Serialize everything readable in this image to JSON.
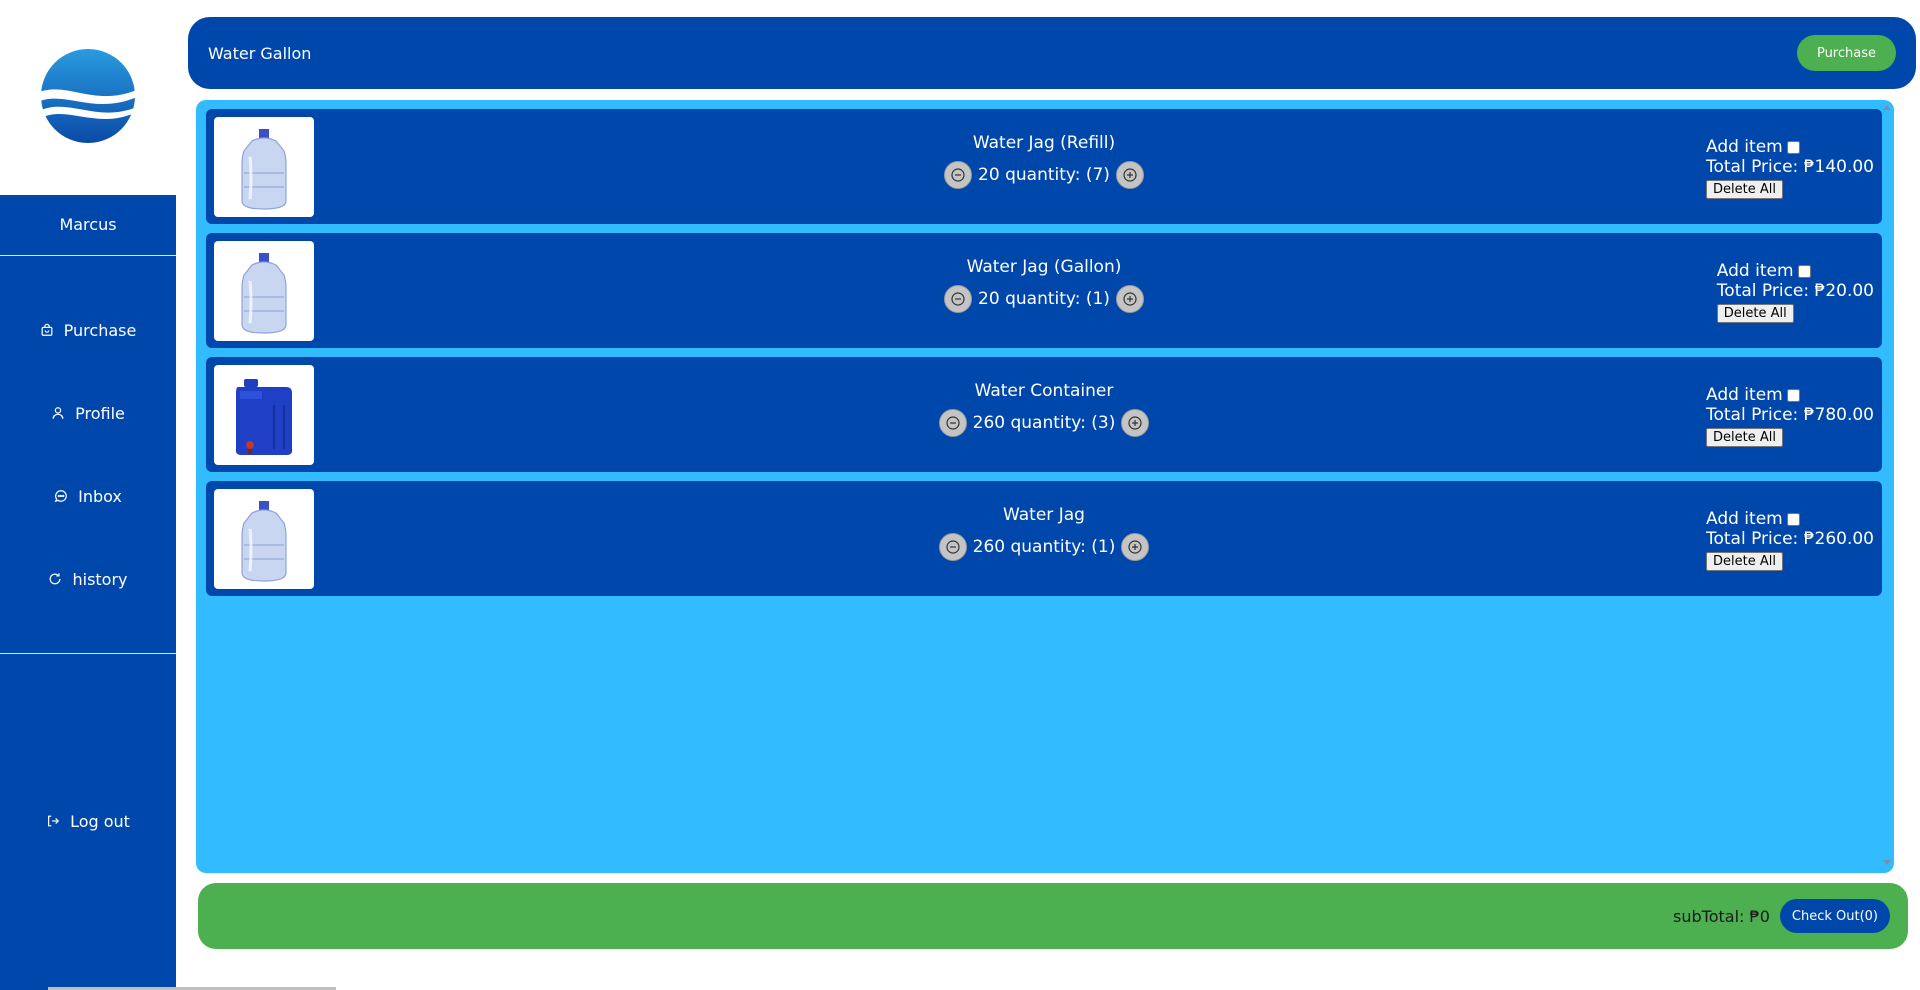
{
  "sidebar": {
    "user_name": "Marcus",
    "nav": [
      {
        "label": "Purchase",
        "icon": "bag-icon"
      },
      {
        "label": "Profile",
        "icon": "user-icon"
      },
      {
        "label": "Inbox",
        "icon": "chat-icon"
      },
      {
        "label": "history",
        "icon": "refresh-icon"
      }
    ],
    "logout": {
      "label": "Log out",
      "icon": "logout-icon"
    }
  },
  "header": {
    "title": "Water Gallon",
    "purchase_label": "Purchase"
  },
  "cart": {
    "add_label": "Add item",
    "delete_label": "Delete All",
    "items": [
      {
        "name": "Water Jag (Refill)",
        "qty_text": "20 quantity: (7)",
        "total": "Total Price: ₱140.00",
        "image": "water-jug"
      },
      {
        "name": "Water Jag (Gallon)",
        "qty_text": "20 quantity: (1)",
        "total": "Total Price: ₱20.00",
        "image": "water-jug"
      },
      {
        "name": "Water Container",
        "qty_text": "260 quantity: (3)",
        "total": "Total Price: ₱780.00",
        "image": "water-container"
      },
      {
        "name": "Water Jag",
        "qty_text": "260 quantity: (1)",
        "total": "Total Price: ₱260.00",
        "image": "water-jug"
      }
    ]
  },
  "footer": {
    "subtotal": "subTotal: ₱0",
    "checkout_label": "Check Out(0)"
  },
  "colors": {
    "primary": "#0047ab",
    "cart_bg": "#33bbff",
    "accent": "#4caf50"
  }
}
